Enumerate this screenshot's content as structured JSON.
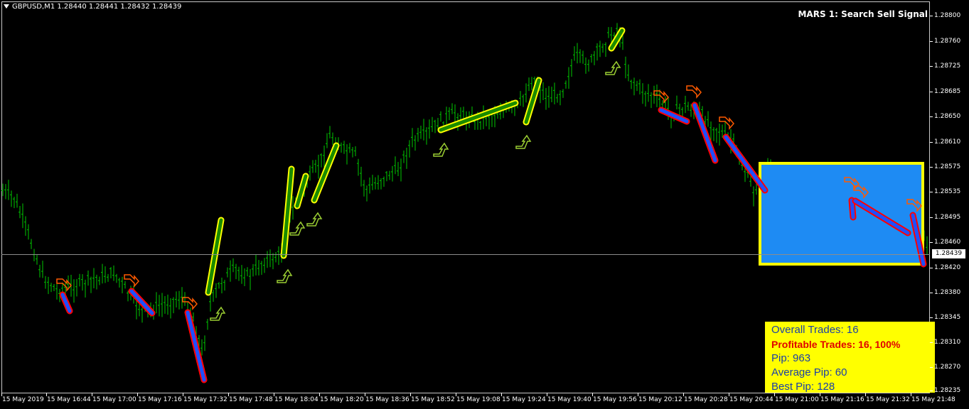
{
  "window": {
    "symbol_info": "GBPUSD,M1  1.28440 1.28441 1.28432 1.28439",
    "indicator_title": "MARS 1: Search Sell Signal"
  },
  "price_axis": {
    "labels": [
      "1.28800",
      "1.28760",
      "1.28725",
      "1.28685",
      "1.28650",
      "1.28610",
      "1.28575",
      "1.28535",
      "1.28495",
      "1.28460",
      "1.28420",
      "1.28380",
      "1.28345",
      "1.28310",
      "1.28270",
      "1.28235"
    ],
    "bid_price": "1.28439"
  },
  "time_axis": {
    "labels": [
      "15 May 2019",
      "15 May 16:44",
      "15 May 17:00",
      "15 May 17:16",
      "15 May 17:32",
      "15 May 17:48",
      "15 May 18:04",
      "15 May 18:20",
      "15 May 18:36",
      "15 May 18:52",
      "15 May 19:08",
      "15 May 19:24",
      "15 May 19:40",
      "15 May 19:56",
      "15 May 20:12",
      "15 May 20:28",
      "15 May 20:44",
      "15 May 21:00",
      "15 May 21:16",
      "15 May 21:32",
      "15 May 21:48"
    ]
  },
  "stats": {
    "overall_trades": "Overall Trades: 16",
    "profitable_trades": "Profitable Trades: 16, 100%",
    "pip": "Pip: 963",
    "average_pip": "Average Pip: 60",
    "best_pip": "Best Pip: 128"
  },
  "colors": {
    "background": "#000000",
    "candles": "#00c800",
    "buy_segment": "#ffff00",
    "sell_segment_outline": "#ff0000",
    "sell_segment_fill": "#1e50ff",
    "signal_box": "#1e8bf3",
    "stats_background": "#ffff00",
    "stats_text": "#1a3fa8",
    "stats_highlight": "#e00000"
  },
  "icons": {
    "buy_signal": "up-arrow-icon",
    "sell_signal": "down-arrow-icon"
  }
}
